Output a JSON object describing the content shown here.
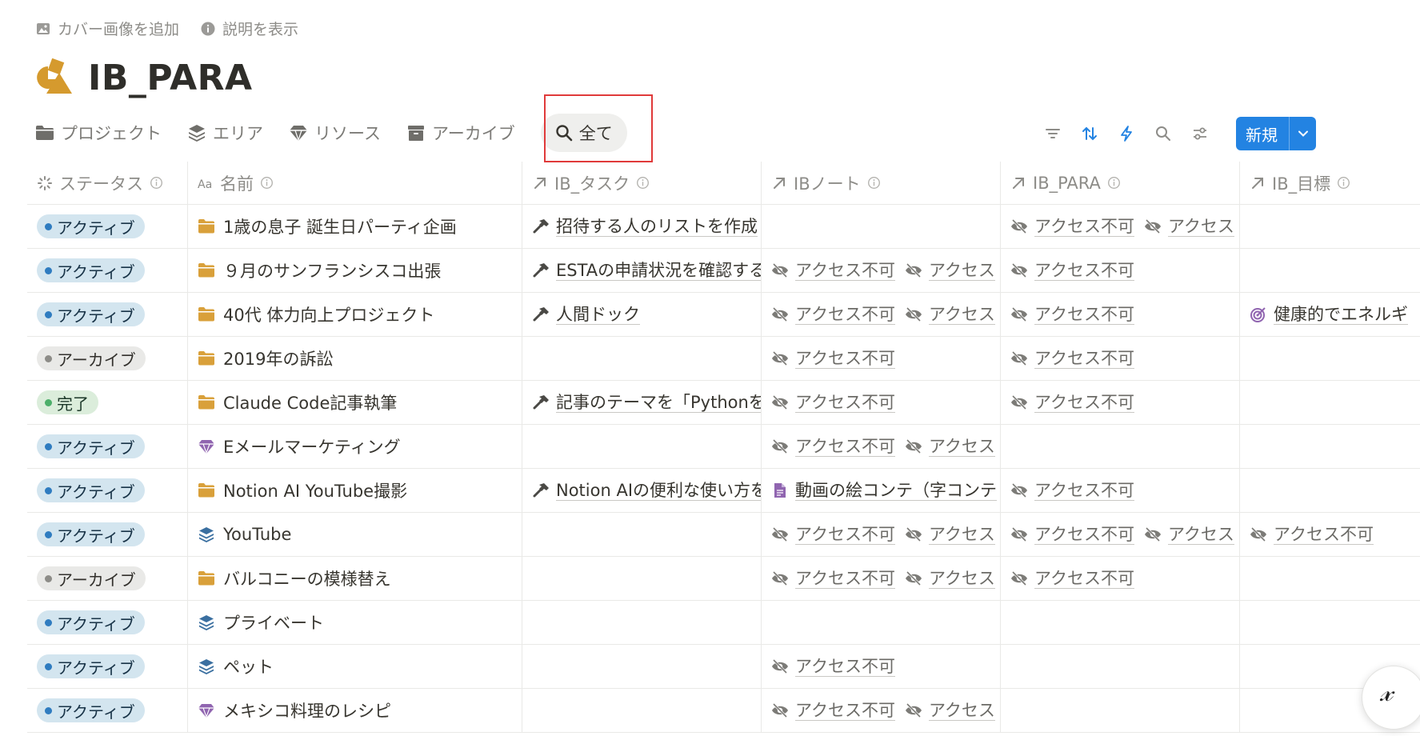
{
  "top_actions": {
    "add_cover": "カバー画像を追加",
    "show_description": "説明を表示"
  },
  "title": "IB_PARA",
  "tabs": [
    {
      "label": "プロジェクト",
      "icon": "folder-icon"
    },
    {
      "label": "エリア",
      "icon": "layers-icon"
    },
    {
      "label": "リソース",
      "icon": "gem-icon"
    },
    {
      "label": "アーカイブ",
      "icon": "archive-box-icon"
    },
    {
      "label": "全て",
      "icon": "search-icon",
      "active": true
    }
  ],
  "toolbar": {
    "new_label": "新規"
  },
  "columns": [
    "ステータス",
    "名前",
    "IB_タスク",
    "IBノート",
    "IB_PARA",
    "IB_目標"
  ],
  "rows": [
    {
      "status": "アクティブ",
      "status_type": "active",
      "icon": "folder",
      "name": "1歳の息子 誕生日パーティ企画",
      "tasks": [
        "招待する人のリストを作成"
      ],
      "notes": [],
      "para": [
        "アクセス不可",
        "アクセス"
      ],
      "goals": []
    },
    {
      "status": "アクティブ",
      "status_type": "active",
      "icon": "folder",
      "name": "９月のサンフランシスコ出張",
      "tasks": [
        "ESTAの申請状況を確認する"
      ],
      "notes": [
        "アクセス不可",
        "アクセス"
      ],
      "para": [
        "アクセス不可"
      ],
      "goals": []
    },
    {
      "status": "アクティブ",
      "status_type": "active",
      "icon": "folder",
      "name": "40代 体力向上プロジェクト",
      "tasks": [
        "人間ドック"
      ],
      "notes": [
        "アクセス不可",
        "アクセス"
      ],
      "para": [
        "アクセス不可"
      ],
      "goals": [
        "健康的でエネルギ"
      ]
    },
    {
      "status": "アーカイブ",
      "status_type": "archive",
      "icon": "folder",
      "name": "2019年の訴訟",
      "tasks": [],
      "notes": [
        "アクセス不可"
      ],
      "para": [
        "アクセス不可"
      ],
      "goals": []
    },
    {
      "status": "完了",
      "status_type": "done",
      "icon": "folder",
      "name": "Claude Code記事執筆",
      "tasks": [
        "記事のテーマを「Pythonを"
      ],
      "notes": [
        "アクセス不可"
      ],
      "para": [
        "アクセス不可"
      ],
      "goals": []
    },
    {
      "status": "アクティブ",
      "status_type": "active",
      "icon": "gem",
      "name": "Eメールマーケティング",
      "tasks": [],
      "notes": [
        "アクセス不可",
        "アクセス"
      ],
      "para": [],
      "goals": []
    },
    {
      "status": "アクティブ",
      "status_type": "active",
      "icon": "folder",
      "name": "Notion AI YouTube撮影",
      "tasks": [
        "Notion AIの便利な使い方を"
      ],
      "notes_doc": [
        "動画の絵コンテ（字コンテ"
      ],
      "notes": [],
      "para": [
        "アクセス不可"
      ],
      "goals": []
    },
    {
      "status": "アクティブ",
      "status_type": "active",
      "icon": "layers",
      "name": "YouTube",
      "tasks": [],
      "notes": [
        "アクセス不可",
        "アクセス"
      ],
      "para": [
        "アクセス不可",
        "アクセス"
      ],
      "goals_noaccess": [
        "アクセス不可"
      ],
      "goals": []
    },
    {
      "status": "アーカイブ",
      "status_type": "archive",
      "icon": "folder",
      "name": "バルコニーの模様替え",
      "tasks": [],
      "notes": [
        "アクセス不可",
        "アクセス"
      ],
      "para": [
        "アクセス不可"
      ],
      "goals": []
    },
    {
      "status": "アクティブ",
      "status_type": "active",
      "icon": "layers",
      "name": "プライベート",
      "tasks": [],
      "notes": [],
      "para": [],
      "goals": []
    },
    {
      "status": "アクティブ",
      "status_type": "active",
      "icon": "layers",
      "name": "ペット",
      "tasks": [],
      "notes": [
        "アクセス不可"
      ],
      "para": [],
      "goals": []
    },
    {
      "status": "アクティブ",
      "status_type": "active",
      "icon": "gem",
      "name": "メキシコ料理のレシピ",
      "tasks": [],
      "notes": [
        "アクセス不可",
        "アクセス"
      ],
      "para": [],
      "goals": []
    }
  ],
  "colors": {
    "accent": "#2383e2",
    "folder": "#d9a03a",
    "gem": "#9065b0",
    "layers": "#3a6fa0",
    "goal": "#9065b0"
  }
}
